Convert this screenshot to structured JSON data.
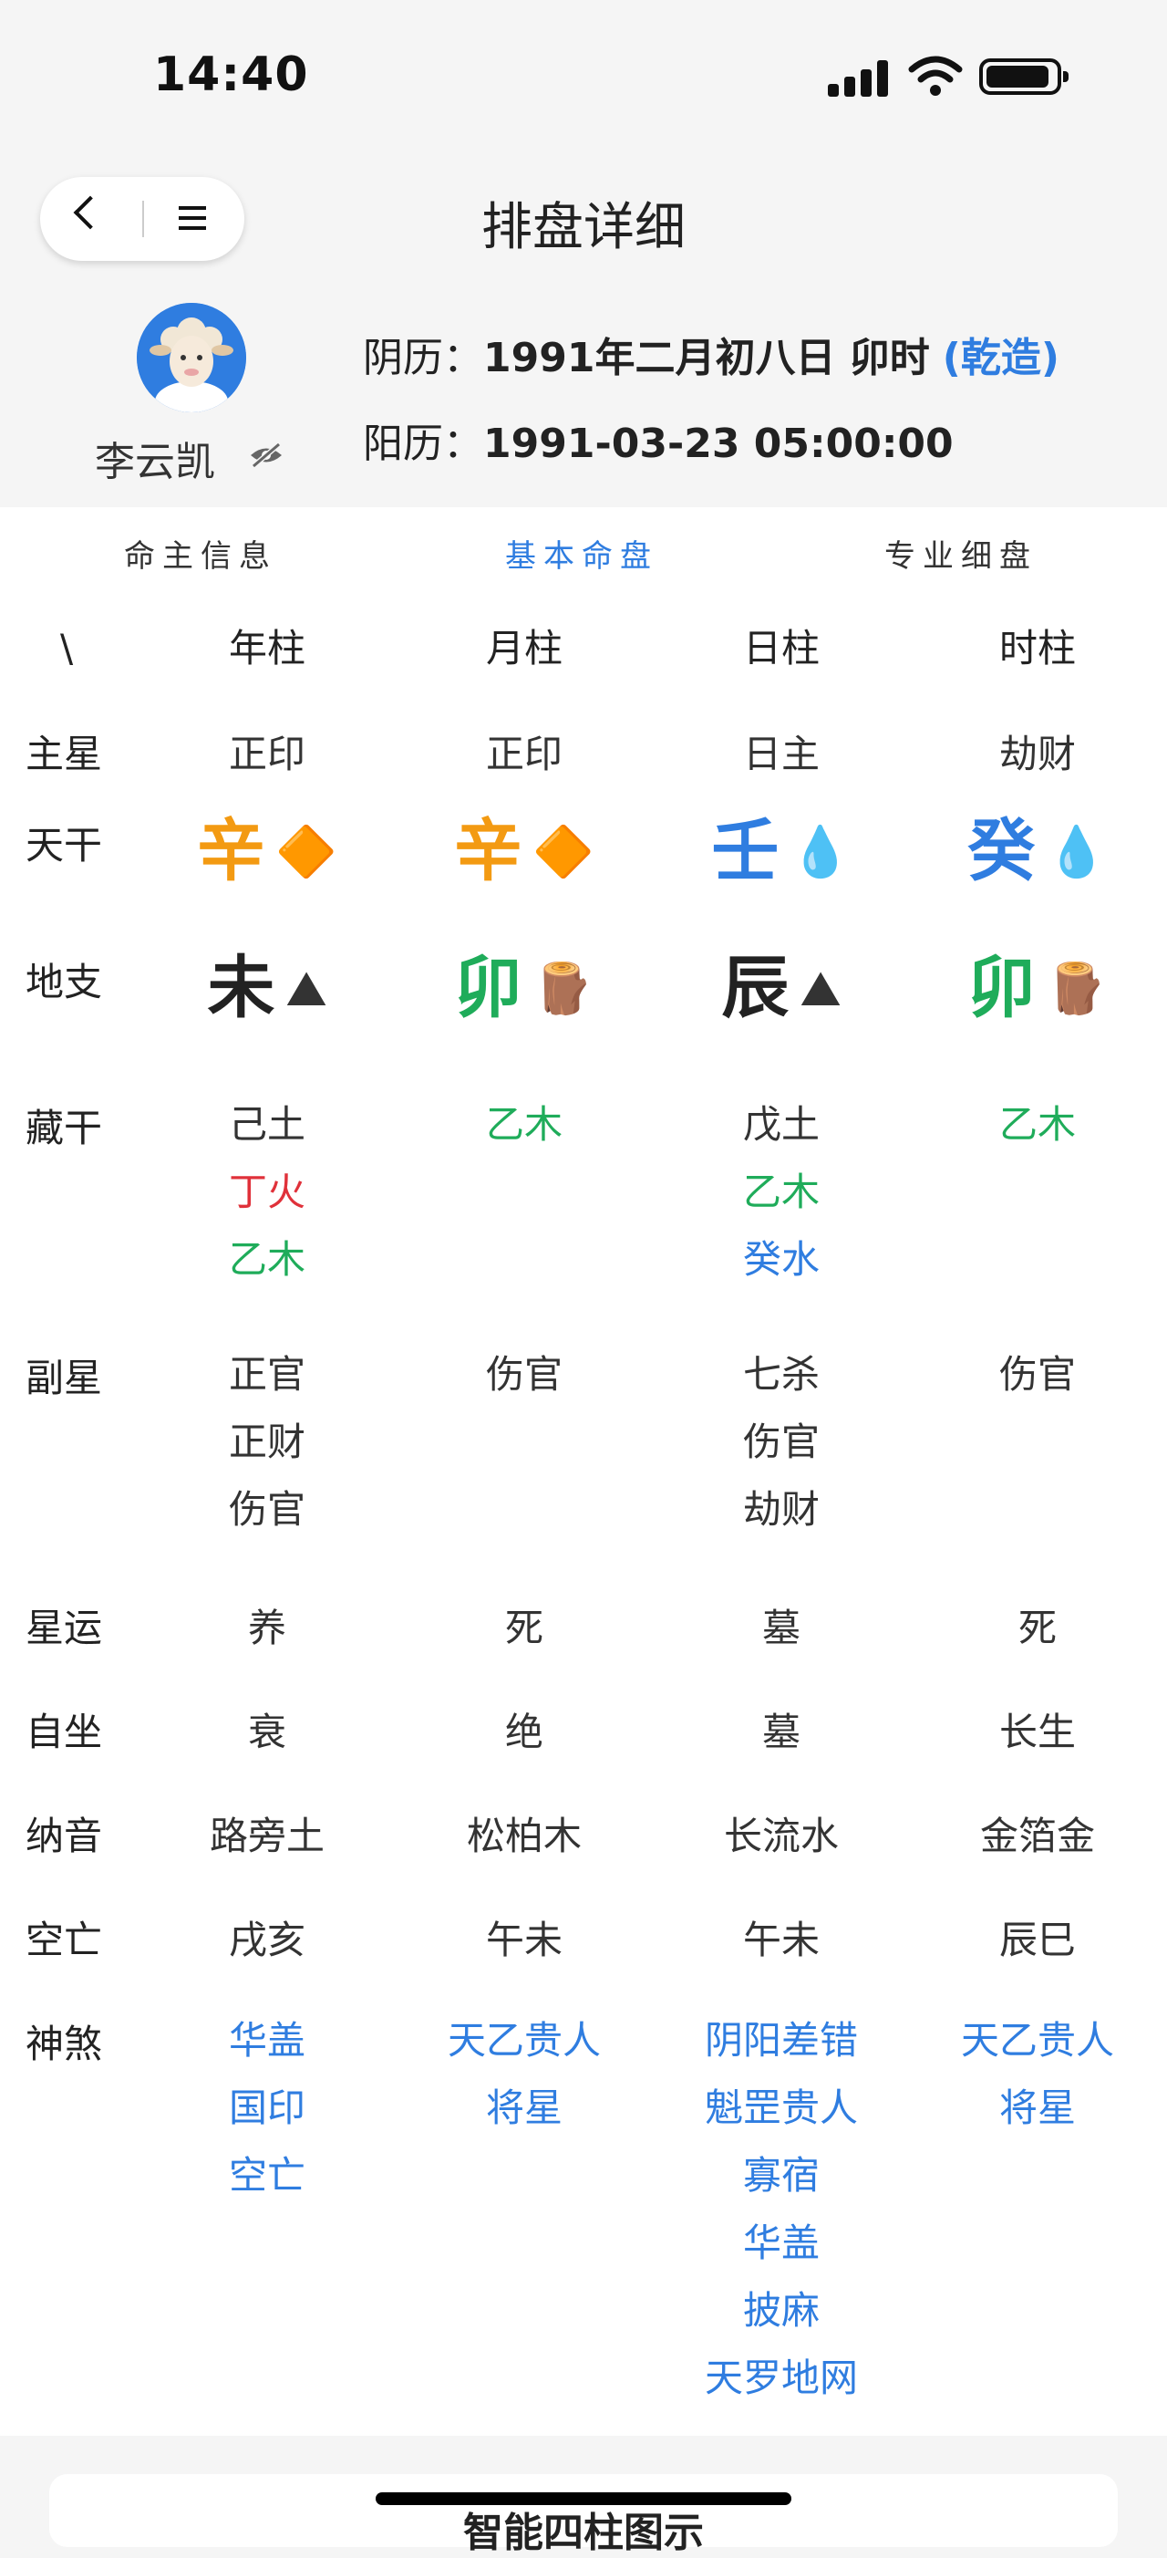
{
  "status": {
    "time": "14:40"
  },
  "nav": {
    "title": "排盘详细"
  },
  "profile": {
    "name": "李云凯",
    "lunar_label": "阴历：",
    "lunar_value": "1991年二月初八日 卯时",
    "gender": "(乾造)",
    "solar_label": "阳历：",
    "solar_value": "1991-03-23 05:00:00"
  },
  "tabs": [
    "命主信息",
    "基本命盘",
    "专业细盘"
  ],
  "active_tab": "基本命盘",
  "table": {
    "corner": "\\",
    "pillars": [
      "年柱",
      "月柱",
      "日柱",
      "时柱"
    ],
    "row_labels": {
      "zhuxing": "主星",
      "tiangan": "天干",
      "dizhi": "地支",
      "canggan": "藏干",
      "fuxing": "副星",
      "xingyun": "星运",
      "zizuo": "自坐",
      "nayin": "纳音",
      "kongwang": "空亡",
      "shensha": "神煞"
    },
    "zhuxing": [
      "正印",
      "正印",
      "日主",
      "劫财"
    ],
    "tiangan": [
      {
        "char": "辛",
        "color": "#f39a12",
        "icon": "gold-pyramid-icon",
        "glyph": "🔶"
      },
      {
        "char": "辛",
        "color": "#f39a12",
        "icon": "gold-pyramid-icon",
        "glyph": "🔶"
      },
      {
        "char": "壬",
        "color": "#2f7de0",
        "icon": "water-drops-icon",
        "glyph": "💧"
      },
      {
        "char": "癸",
        "color": "#2f7de0",
        "icon": "water-drops-icon",
        "glyph": "💧"
      }
    ],
    "dizhi": [
      {
        "char": "未",
        "color": "#222222",
        "icon": "earth-mound-icon",
        "glyph": "⛰"
      },
      {
        "char": "卯",
        "color": "#1fac5a",
        "icon": "wood-logs-icon",
        "glyph": "🪵"
      },
      {
        "char": "辰",
        "color": "#222222",
        "icon": "earth-mound-icon",
        "glyph": "⛰"
      },
      {
        "char": "卯",
        "color": "#1fac5a",
        "icon": "wood-logs-icon",
        "glyph": "🪵"
      }
    ],
    "canggan": [
      [
        {
          "text": "己土",
          "color": "#333333"
        },
        {
          "text": "丁火",
          "color": "#e0313a"
        },
        {
          "text": "乙木",
          "color": "#1fac5a"
        }
      ],
      [
        {
          "text": "乙木",
          "color": "#1fac5a"
        }
      ],
      [
        {
          "text": "戊土",
          "color": "#333333"
        },
        {
          "text": "乙木",
          "color": "#1fac5a"
        },
        {
          "text": "癸水",
          "color": "#2f7de0"
        }
      ],
      [
        {
          "text": "乙木",
          "color": "#1fac5a"
        }
      ]
    ],
    "fuxing": [
      [
        "正官",
        "正财",
        "伤官"
      ],
      [
        "伤官"
      ],
      [
        "七杀",
        "伤官",
        "劫财"
      ],
      [
        "伤官"
      ]
    ],
    "xingyun": [
      "养",
      "死",
      "墓",
      "死"
    ],
    "zizuo": [
      "衰",
      "绝",
      "墓",
      "长生"
    ],
    "nayin": [
      "路旁土",
      "松柏木",
      "长流水",
      "金箔金"
    ],
    "kongwang": [
      "戌亥",
      "午未",
      "午未",
      "辰巳"
    ],
    "shensha": [
      [
        "华盖",
        "国印",
        "空亡"
      ],
      [
        "天乙贵人",
        "将星"
      ],
      [
        "阴阳差错",
        "魁罡贵人",
        "寡宿",
        "华盖",
        "披麻",
        "天罗地网"
      ],
      [
        "天乙贵人",
        "将星"
      ]
    ]
  },
  "bottom_card": {
    "title": "智能四柱图示"
  },
  "colors": {
    "accent": "#2f7de0",
    "metal": "#f39a12",
    "wood": "#1fac5a",
    "fire": "#e0313a"
  }
}
